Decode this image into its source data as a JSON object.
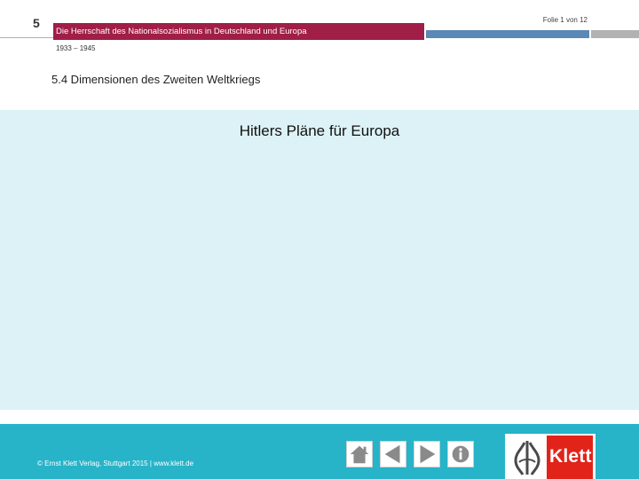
{
  "header": {
    "chapter_number": "5",
    "slide_counter": "Folie 1 von 12",
    "title": "Die Herrschaft des Nationalsozialismus in Deutschland und Europa",
    "subtitle": "1933 – 1945"
  },
  "section": {
    "title": "5.4 Dimensionen des Zweiten Weltkriegs"
  },
  "slide": {
    "title": "Hitlers Pläne für Europa"
  },
  "footer": {
    "copyright": "© Ernst Klett Verlag, Stuttgart 2015 | www.klett.de",
    "nav": [
      {
        "icon": "home-icon"
      },
      {
        "icon": "arrow-left-icon"
      },
      {
        "icon": "arrow-right-icon"
      },
      {
        "icon": "info-icon"
      }
    ],
    "logo": {
      "text": "Klett"
    }
  },
  "colors": {
    "header_red": "#a01e48",
    "header_blue": "#5b88b5",
    "content_background": "#dcf2f7",
    "footer_teal": "#27b3c8",
    "logo_red": "#e2231a"
  }
}
